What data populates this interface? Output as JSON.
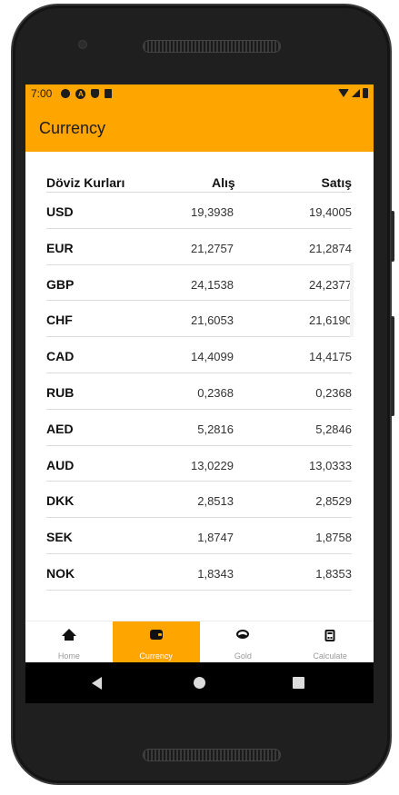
{
  "status": {
    "time": "7:00"
  },
  "appbar": {
    "title": "Currency"
  },
  "table": {
    "headers": {
      "name": "Döviz Kurları",
      "buy": "Alış",
      "sell": "Satış"
    },
    "rows": [
      {
        "code": "USD",
        "buy": "19,3938",
        "sell": "19,4005"
      },
      {
        "code": "EUR",
        "buy": "21,2757",
        "sell": "21,2874"
      },
      {
        "code": "GBP",
        "buy": "24,1538",
        "sell": "24,2377"
      },
      {
        "code": "CHF",
        "buy": "21,6053",
        "sell": "21,6190"
      },
      {
        "code": "CAD",
        "buy": "14,4099",
        "sell": "14,4175"
      },
      {
        "code": "RUB",
        "buy": "0,2368",
        "sell": "0,2368"
      },
      {
        "code": "AED",
        "buy": "5,2816",
        "sell": "5,2846"
      },
      {
        "code": "AUD",
        "buy": "13,0229",
        "sell": "13,0333"
      },
      {
        "code": "DKK",
        "buy": "2,8513",
        "sell": "2,8529"
      },
      {
        "code": "SEK",
        "buy": "1,8747",
        "sell": "1,8758"
      },
      {
        "code": "NOK",
        "buy": "1,8343",
        "sell": "1,8353"
      }
    ]
  },
  "bottom_nav": {
    "items": [
      {
        "label": "Home",
        "icon": "home-icon"
      },
      {
        "label": "Currency",
        "icon": "wallet-icon",
        "active": true
      },
      {
        "label": "Gold",
        "icon": "gold-icon"
      },
      {
        "label": "Calculate",
        "icon": "calculator-icon"
      }
    ]
  },
  "colors": {
    "accent": "#ffa500",
    "nav_inactive": "#9a9a9a"
  }
}
